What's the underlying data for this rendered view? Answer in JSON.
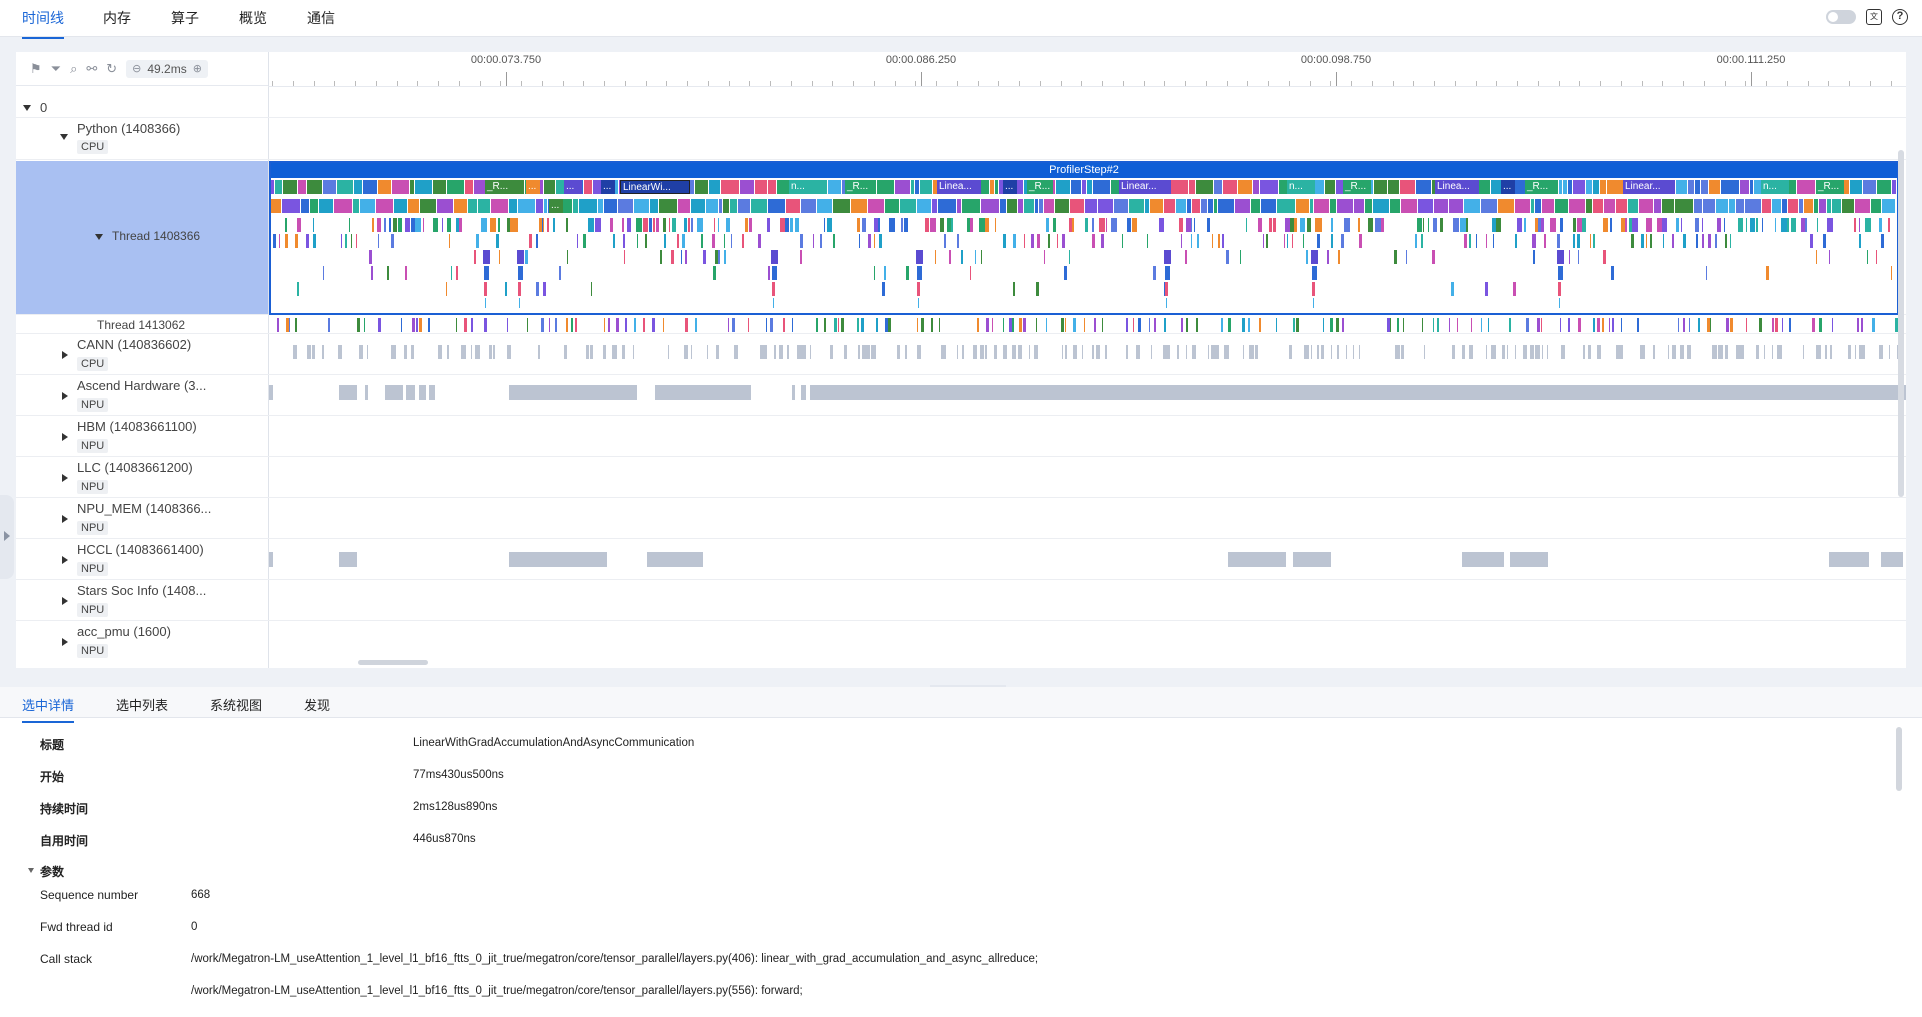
{
  "tabs": [
    {
      "label": "时间线",
      "active": true
    },
    {
      "label": "内存",
      "active": false
    },
    {
      "label": "算子",
      "active": false
    },
    {
      "label": "概览",
      "active": false
    },
    {
      "label": "通信",
      "active": false
    }
  ],
  "toolbar": {
    "zoom": "49.2ms"
  },
  "ruler": {
    "labels": [
      "00:00.073.750",
      "00:00.086.250",
      "00:00.098.750",
      "00:00.111.250"
    ]
  },
  "tree": {
    "root": "0",
    "python": {
      "name": "Python (1408366)",
      "badge": "CPU"
    },
    "thread_main": "Thread 1408366",
    "thread_2": "Thread 1413062",
    "cann": {
      "name": "CANN (140836602)",
      "badge": "CPU"
    },
    "ascend": {
      "name": "Ascend Hardware (3...",
      "badge": "NPU"
    },
    "hbm": {
      "name": "HBM (14083661100)",
      "badge": "NPU"
    },
    "llc": {
      "name": "LLC (14083661200)",
      "badge": "NPU"
    },
    "npu_mem": {
      "name": "NPU_MEM (1408366...",
      "badge": "NPU"
    },
    "hccl": {
      "name": "HCCL (14083661400)",
      "badge": "NPU"
    },
    "stars": {
      "name": "Stars Soc Info (1408...",
      "badge": "NPU"
    },
    "acc": {
      "name": "acc_pmu (1600)",
      "badge": "NPU"
    }
  },
  "flame": {
    "step_label": "ProfilerStep#2",
    "labels": [
      "_R...",
      "...",
      "...",
      "...",
      "LinearWi...",
      "n...",
      "_R...",
      "Linea...",
      "...",
      "_R...",
      "Linear...",
      "n...",
      "_R...",
      "Linea...",
      "...",
      "_R...",
      "Linear...",
      "n...",
      "_R...",
      "..."
    ]
  },
  "colors": {
    "accent": "#1a66d6",
    "step": "#0f5fd6",
    "selection": "#a9c0f2",
    "hardware_block": "#bcc4d2"
  },
  "detail": {
    "tabs": [
      {
        "label": "选中详情",
        "active": true
      },
      {
        "label": "选中列表",
        "active": false
      },
      {
        "label": "系统视图",
        "active": false
      },
      {
        "label": "发现",
        "active": false
      }
    ],
    "title_label": "标题",
    "title_value": "LinearWithGradAccumulationAndAsyncCommunication",
    "start_label": "开始",
    "start_value": "77ms430us500ns",
    "duration_label": "持续时间",
    "duration_value": "2ms128us890ns",
    "self_label": "自用时间",
    "self_value": "446us870ns",
    "params_label": "参数",
    "seq_label": "Sequence number",
    "seq_value": "668",
    "fwd_label": "Fwd thread id",
    "fwd_value": "0",
    "callstack_label": "Call stack",
    "callstack": [
      "/work/Megatron-LM_useAttention_1_level_l1_bf16_ftts_0_jit_true/megatron/core/tensor_parallel/layers.py(406): linear_with_grad_accumulation_and_async_allreduce;",
      "/work/Megatron-LM_useAttention_1_level_l1_bf16_ftts_0_jit_true/megatron/core/tensor_parallel/layers.py(556): forward;"
    ]
  }
}
